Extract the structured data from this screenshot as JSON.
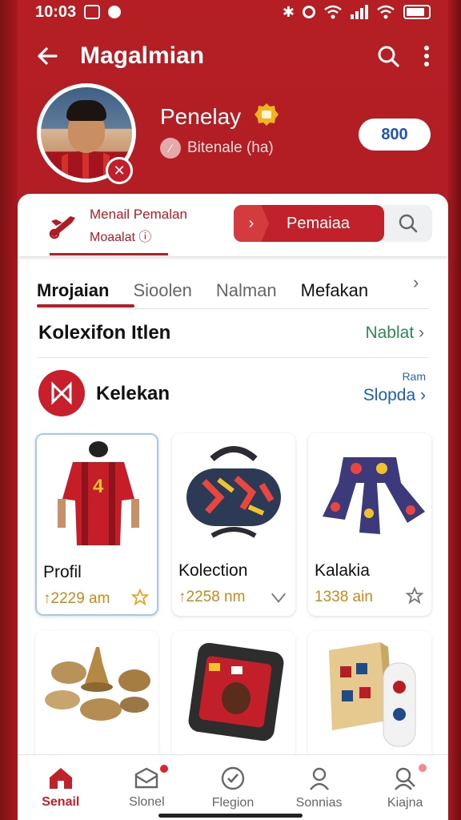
{
  "status": {
    "time": "10:03"
  },
  "appbar": {
    "title": "Magalmian"
  },
  "profile": {
    "name": "Penelay",
    "subtitle": "Bitenale (ha)",
    "score": "800"
  },
  "actionbar": {
    "left_line1": "Menail Pemalan",
    "left_line2": "Moaalat",
    "button_label": "Pemaiaa"
  },
  "tabs": [
    "Mrojaian",
    "Sioolen",
    "Nalman",
    "Mefakan"
  ],
  "section": {
    "title": "Kolexifon Itlen",
    "link": "Nablat"
  },
  "collection": {
    "title": "Kelekan",
    "small": "Ram",
    "link": "Slopda"
  },
  "cards": [
    {
      "name": "Profil",
      "price": "↑2229 am"
    },
    {
      "name": "Kolection",
      "price": "↑2258 nm"
    },
    {
      "name": "Kalakia",
      "price": "1338 ain"
    }
  ],
  "nav": [
    {
      "label": "Senail"
    },
    {
      "label": "Slonel"
    },
    {
      "label": "Flegion"
    },
    {
      "label": "Sonnias"
    },
    {
      "label": "Kiajna"
    }
  ],
  "colors": {
    "primary": "#b51f24",
    "accent_blue": "#1a5fb4",
    "price": "#c88a16"
  }
}
